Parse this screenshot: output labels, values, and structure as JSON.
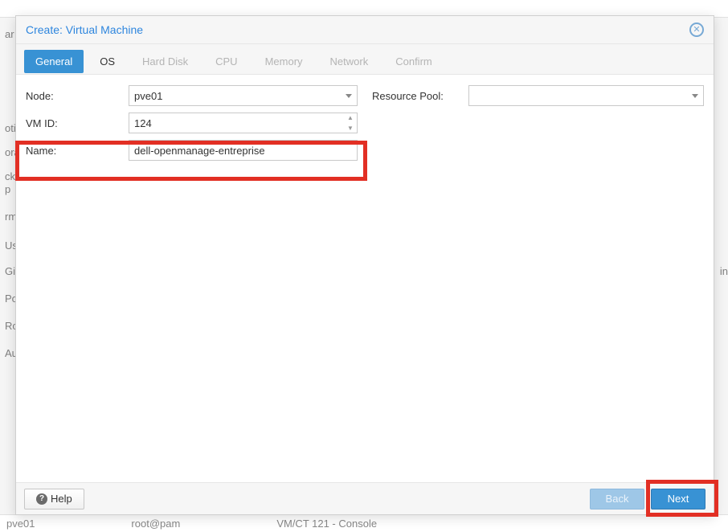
{
  "dialog": {
    "title": "Create: Virtual Machine"
  },
  "tabs": [
    {
      "label": "General",
      "state": "active"
    },
    {
      "label": "OS",
      "state": "enabled"
    },
    {
      "label": "Hard Disk",
      "state": "disabled"
    },
    {
      "label": "CPU",
      "state": "disabled"
    },
    {
      "label": "Memory",
      "state": "disabled"
    },
    {
      "label": "Network",
      "state": "disabled"
    },
    {
      "label": "Confirm",
      "state": "disabled"
    }
  ],
  "fields": {
    "node": {
      "label": "Node:",
      "value": "pve01"
    },
    "vmid": {
      "label": "VM ID:",
      "value": "124"
    },
    "name": {
      "label": "Name:",
      "value": "dell-openmanage-entreprise"
    },
    "resource_pool": {
      "label": "Resource Pool:",
      "value": ""
    }
  },
  "footer": {
    "help": "Help",
    "back": "Back",
    "next": "Next"
  },
  "background": {
    "status_node": "pve01",
    "status_user": "root@pam",
    "status_title": "VM/CT 121 - Console",
    "side_items": [
      "ar",
      "otio",
      "ora",
      "ck",
      "p",
      "rm",
      "Us",
      "Gi",
      "Po",
      "Ro",
      "Au"
    ],
    "right_edge": "in"
  }
}
